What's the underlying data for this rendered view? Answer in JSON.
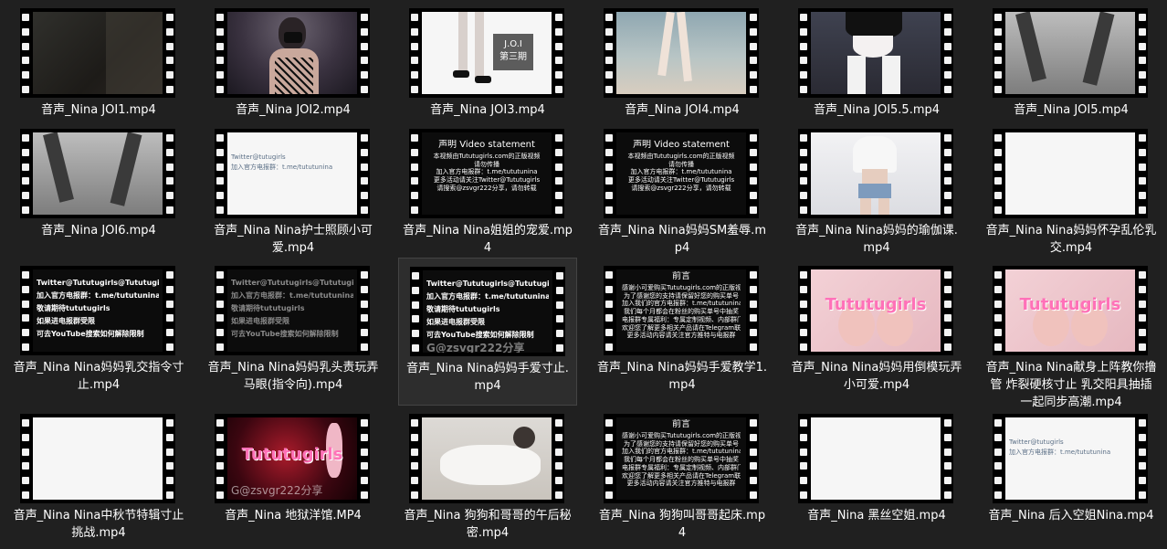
{
  "files": [
    {
      "name": "音声_Nina JOI1.mp4",
      "style": "dark",
      "overlay": []
    },
    {
      "name": "音声_Nina JOI2.mp4",
      "style": "purple",
      "overlay": []
    },
    {
      "name": "音声_Nina JOI3.mp4",
      "style": "white",
      "overlay": [
        "J.O.I",
        "第三期"
      ]
    },
    {
      "name": "音声_Nina JOI4.mp4",
      "style": "beach",
      "overlay": []
    },
    {
      "name": "音声_Nina JOI5.5.mp4",
      "style": "room",
      "overlay": []
    },
    {
      "name": "音声_Nina JOI5.mp4",
      "style": "gray",
      "overlay": []
    },
    {
      "name": "音声_Nina JOI6.mp4",
      "style": "gray",
      "overlay": []
    },
    {
      "name": "音声_Nina Nina护士照顾小可爱.mp4",
      "style": "social",
      "overlay": [
        "Twitter@tutugirls",
        "加入官方电报群：t.me/tututunina"
      ]
    },
    {
      "name": "音声_Nina Nina姐姐的宠爱.mp4",
      "style": "statement",
      "overlay": [
        "声明 Video statement",
        "本视频由Tututugirls.com的正版视频",
        "请勿传播",
        "加入官方电报群：t.me/tututunina",
        "更多活动请关注Twitter@Tututugirls",
        "请搜索@zsvgr222分享，请勿转载"
      ]
    },
    {
      "name": "音声_Nina Nina妈妈SM羞辱.mp4",
      "style": "statement",
      "overlay": [
        "声明 Video statement",
        "本视频由Tututugirls.com的正版视频",
        "请勿传播",
        "加入官方电报群：t.me/tututunina",
        "更多活动请关注Twitter@Tututugirls",
        "请搜索@zsvgr222分享，请勿转载"
      ]
    },
    {
      "name": "音声_Nina Nina妈妈的瑜伽课.mp4",
      "style": "light",
      "overlay": []
    },
    {
      "name": "音声_Nina Nina妈妈怀孕乱伦乳交.mp4",
      "style": "white",
      "overlay": []
    },
    {
      "name": "音声_Nina Nina妈妈乳交指令寸止.mp4",
      "style": "twitter-bright",
      "overlay": [
        "Twitter@Tututugirls@Tututugirlshome",
        "加入官方电报群：t.me/tututunina",
        "敬请期待tututugirls",
        "如果进电报群受限",
        "可去YouTube搜索如何解除限制"
      ]
    },
    {
      "name": "音声_Nina Nina妈妈乳头责玩弄马眼(指令向).mp4",
      "style": "twitter-dim",
      "overlay": [
        "Twitter@Tututugirls@Tututugirlshome",
        "加入官方电报群：t.me/tututunina",
        "敬请期待tututugirls",
        "如果进电报群受限",
        "可去YouTube搜索如何解除限制"
      ]
    },
    {
      "name": "音声_Nina Nina妈妈手爱寸止.mp4",
      "style": "twitter-bright",
      "overlay": [
        "Twitter@Tututugirls@Tututugirlshome",
        "加入官方电报群：t.me/tututunina",
        "敬请期待tututugirls",
        "如果进电报群受限",
        "可去YouTube搜索如何解除限制",
        "G@zsvgr222分享"
      ]
    },
    {
      "name": "音声_Nina Nina妈妈手爱教学1.mp4",
      "style": "foreword",
      "overlay": [
        "前言",
        "感谢小可爱购买Tututugirls.com的正版视频",
        "为了感谢您的支持请保留好您的购买单号",
        "加入我们的官方电报群：t.me/tututunina",
        "我们每个月都会在粉丝的购买单号中抽奖",
        "电报群专属福利：专属定制视频、内部群门票、模特相关",
        "欢迎您了解更多相关产品请在Telegram联系tututu",
        "更多活动内容请关注官方推特与电报群"
      ]
    },
    {
      "name": "音声_Nina Nina妈妈用倒模玩弄小可爱.mp4",
      "style": "pink",
      "overlay": [
        "Tututugirls"
      ]
    },
    {
      "name": "音声_Nina Nina献身上阵教你撸管 炸裂硬核寸止 乳交阳具抽插一起同步高潮.mp4",
      "style": "pink",
      "overlay": [
        "Tututugirls"
      ]
    },
    {
      "name": "音声_Nina Nina中秋节特辑寸止挑战.mp4",
      "style": "white",
      "overlay": []
    },
    {
      "name": "音声_Nina 地狱洋馆.MP4",
      "style": "club",
      "overlay": [
        "Tututugirls",
        "G@zsvgr222分享"
      ]
    },
    {
      "name": "音声_Nina 狗狗和哥哥的午后秘密.mp4",
      "style": "bed",
      "overlay": []
    },
    {
      "name": "音声_Nina 狗狗叫哥哥起床.mp4",
      "style": "foreword",
      "overlay": [
        "前言",
        "感谢小可爱购买Tututugirls.com的正版视频",
        "为了感谢您的支持请保留好您的购买单号",
        "加入我们的官方电报群：t.me/tututunina",
        "我们每个月都会在粉丝的购买单号中抽奖",
        "电报群专属福利：专属定制视频、内部群门票、模特相关",
        "欢迎您了解更多相关产品请在Telegram联系tututu",
        "更多活动内容请关注官方推特与电报群"
      ]
    },
    {
      "name": "音声_Nina 黑丝空姐.mp4",
      "style": "white",
      "overlay": []
    },
    {
      "name": "音声_Nina 后入空姐Nina.mp4",
      "style": "social",
      "overlay": [
        "Twitter@tutugirls",
        "加入官方电报群：t.me/tututunina"
      ]
    }
  ],
  "selected_index": 14,
  "colors": {
    "background": "#202020",
    "selected_tile": "#2d2d2d",
    "caption": "#ffffff",
    "brand_pink": "#ff71b8"
  }
}
